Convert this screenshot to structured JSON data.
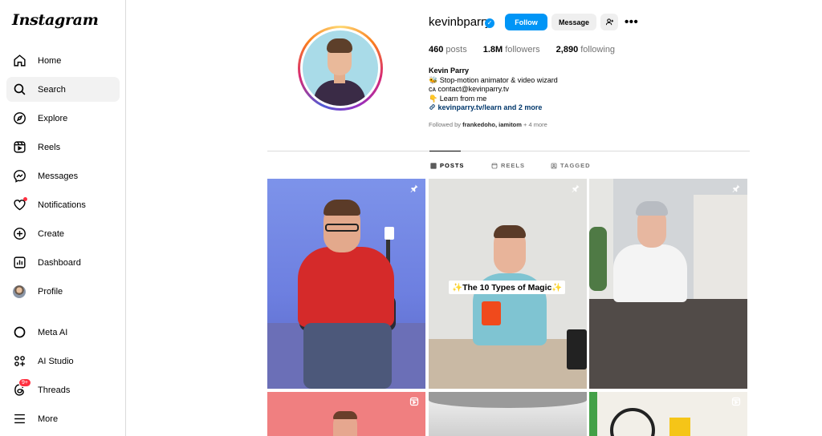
{
  "app": {
    "logo": "Instagram"
  },
  "sidebar": {
    "items": [
      {
        "label": "Home",
        "icon": "home-icon"
      },
      {
        "label": "Search",
        "icon": "search-icon"
      },
      {
        "label": "Explore",
        "icon": "compass-icon"
      },
      {
        "label": "Reels",
        "icon": "reels-icon"
      },
      {
        "label": "Messages",
        "icon": "messenger-icon"
      },
      {
        "label": "Notifications",
        "icon": "heart-icon"
      },
      {
        "label": "Create",
        "icon": "plus-square-icon"
      },
      {
        "label": "Dashboard",
        "icon": "chart-icon"
      },
      {
        "label": "Profile",
        "icon": "avatar"
      },
      {
        "label": "Meta AI",
        "icon": "meta-ai-icon"
      },
      {
        "label": "AI Studio",
        "icon": "ai-studio-icon"
      },
      {
        "label": "Threads",
        "icon": "threads-icon",
        "badge": "9+"
      },
      {
        "label": "More",
        "icon": "menu-icon"
      }
    ]
  },
  "profile": {
    "username": "kevinbparry",
    "follow_label": "Follow",
    "message_label": "Message",
    "posts_count": "460",
    "posts_label": "posts",
    "followers_count": "1.8M",
    "followers_label": "followers",
    "following_count": "2,890",
    "following_label": "following",
    "display_name": "Kevin Parry",
    "bio_line1": "🐝 Stop-motion animator & video wizard",
    "bio_line2": "ᴄᴀ contact@kevinparry.tv",
    "bio_line3": "👇 Learn from me",
    "bio_link": "kevinparry.tv/learn and 2 more",
    "followed_by_prefix": "Followed by",
    "followed_by_names": "frankedoho, iamitom",
    "followed_by_more": "+ 4 more"
  },
  "tabs": [
    {
      "label": "POSTS",
      "icon": "grid-icon",
      "active": true
    },
    {
      "label": "REELS",
      "icon": "reels-icon",
      "active": false
    },
    {
      "label": "TAGGED",
      "icon": "tagged-icon",
      "active": false
    }
  ],
  "posts": [
    {
      "kind": "pinned",
      "bg": "#6a7fe0"
    },
    {
      "kind": "pinned",
      "bg": "#dfe3e6",
      "caption": "✨The 10 Types of Magic✨"
    },
    {
      "kind": "pinned",
      "bg": "#c8cdd2"
    },
    {
      "kind": "reel",
      "bg": "#f07f80"
    },
    {
      "kind": "none",
      "bg": "#e7e7e7"
    },
    {
      "kind": "reel",
      "bg": "#f2efe8"
    }
  ]
}
